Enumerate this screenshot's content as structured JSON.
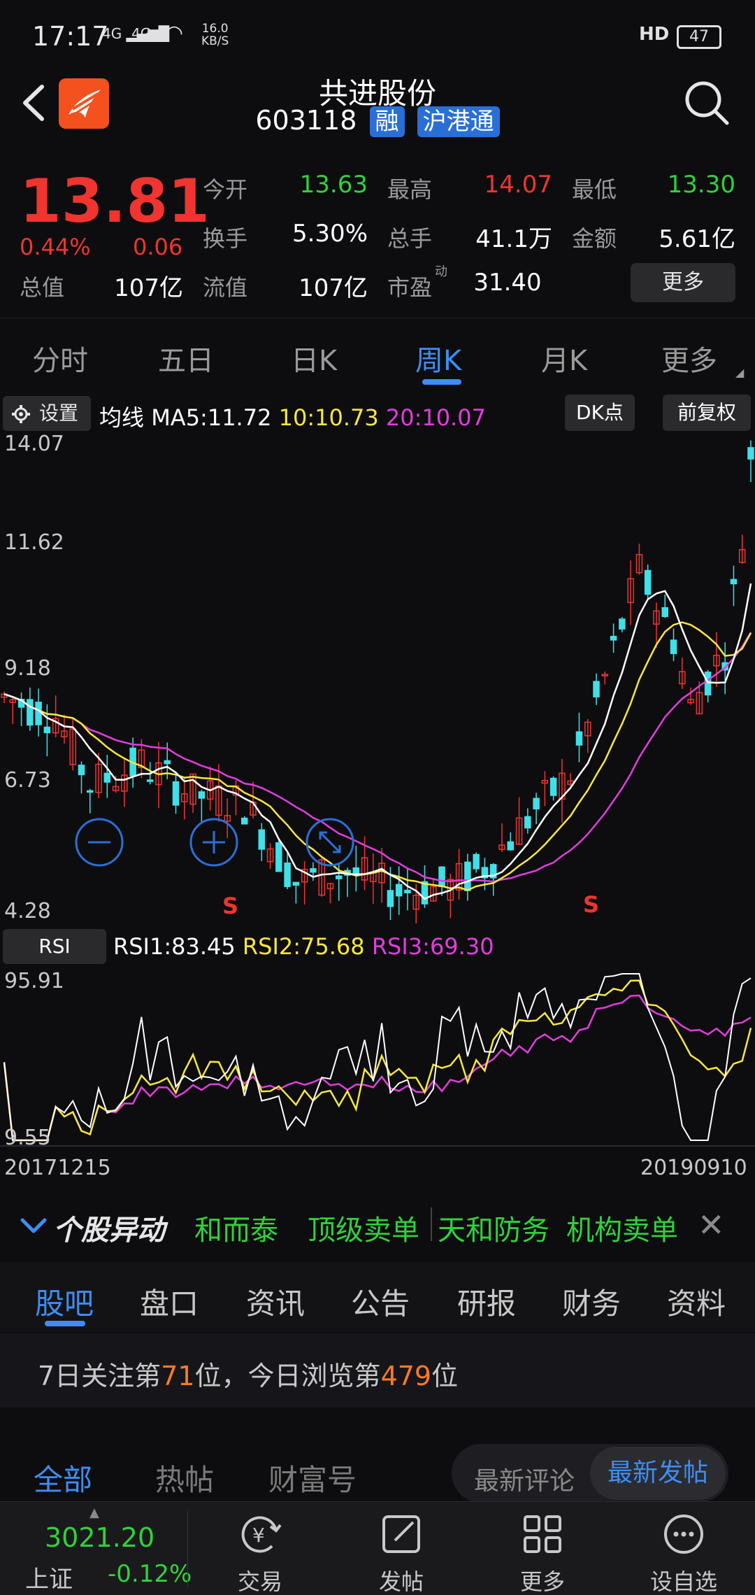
{
  "status": {
    "time": "17:17",
    "sig1": "4G",
    "sig2": "4G",
    "speed_val": "16.0",
    "speed_unit": "KB/S",
    "hd": "HD",
    "battery": "47"
  },
  "header": {
    "title": "共进股份",
    "code": "603118",
    "tag1": "融",
    "tag2": "沪港通"
  },
  "quote": {
    "price": "13.81",
    "pct": "0.44%",
    "chg": "0.06",
    "open_label": "今开",
    "open": "13.63",
    "high_label": "最高",
    "high": "14.07",
    "low_label": "最低",
    "low": "13.30",
    "turnover_label": "换手",
    "turnover": "5.30%",
    "volume_label": "总手",
    "volume": "41.1万",
    "amount_label": "金额",
    "amount": "5.61亿",
    "mktcap_label": "总值",
    "mktcap": "107亿",
    "float_label": "流值",
    "float": "107亿",
    "pe_label": "市盈",
    "pe_sup": "动",
    "pe": "31.40",
    "more": "更多"
  },
  "chart_tabs": [
    "分时",
    "五日",
    "日K",
    "周K",
    "月K",
    "更多"
  ],
  "ma": {
    "settings": "设置",
    "label": "均线",
    "ma5": "MA5:11.72",
    "ma10": "10:10.73",
    "ma20": "20:10.07",
    "dk": "DK点",
    "fq": "前复权"
  },
  "kchart": {
    "y_top": "14.07",
    "y2": "11.62",
    "y3": "9.18",
    "y4": "6.73",
    "y_bottom": "4.28",
    "signal": "S"
  },
  "rsi": {
    "button": "RSI",
    "rsi1": "RSI1:83.45",
    "rsi2": "RSI2:75.68",
    "rsi3": "RSI3:69.30",
    "y_top": "95.91",
    "y_bottom": "9.55"
  },
  "dates": {
    "start": "20171215",
    "end": "20190910"
  },
  "alert": {
    "title": "个股异动",
    "items": [
      "和而泰",
      "顶级卖单",
      "天和防务",
      "机构卖单"
    ]
  },
  "section_tabs": [
    "股吧",
    "盘口",
    "资讯",
    "公告",
    "研报",
    "财务",
    "资料"
  ],
  "rank": {
    "p1": "7日关注第",
    "n1": "71",
    "p2": "位，今日浏览第",
    "n2": "479",
    "p3": "位"
  },
  "filter": {
    "tabs": [
      "全部",
      "热帖",
      "财富号"
    ],
    "sort_comment": "最新评论",
    "sort_new": "最新发帖"
  },
  "bottom": {
    "index_val": "3021.20",
    "index_name": "上证",
    "index_chg": "-0.12%",
    "nav": [
      "交易",
      "发帖",
      "更多",
      "设自选"
    ]
  },
  "colors": {
    "up": "#f0342f",
    "down": "#2fd23a",
    "accent": "#3d8ef5",
    "ma5": "#ffffff",
    "ma10": "#f7e83b",
    "ma20": "#e23ddd",
    "candle_down": "#3fe0e8"
  }
}
